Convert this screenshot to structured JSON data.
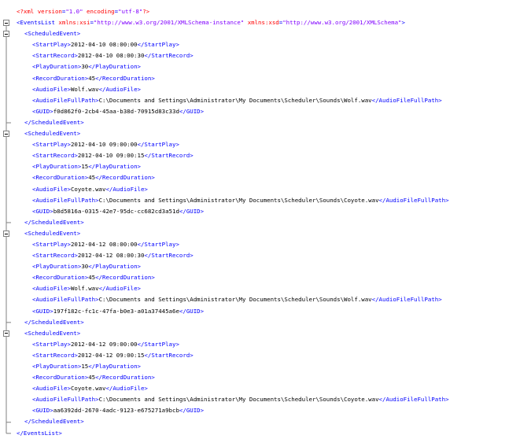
{
  "xml_declaration": {
    "open": "<?xml",
    "attrs": [
      {
        "name": "version",
        "value": "\"1.0\""
      },
      {
        "name": "encoding",
        "value": "\"utf-8\""
      }
    ],
    "close": "?>"
  },
  "root": {
    "tag": "EventsList",
    "attrs": [
      {
        "name": "xmlns:xsi",
        "value": "\"http://www.w3.org/2001/XMLSchema-instance\""
      },
      {
        "name": "xmlns:xsd",
        "value": "\"http://www.w3.org/2001/XMLSchema\""
      }
    ]
  },
  "child_tag": "ScheduledEvent",
  "field_names": [
    "StartPlay",
    "StartRecord",
    "PlayDuration",
    "RecordDuration",
    "AudioFile",
    "AudioFileFullPath",
    "GUID"
  ],
  "events": [
    {
      "StartPlay": "2012-04-10 08:00:00",
      "StartRecord": "2012-04-10 08:00:30",
      "PlayDuration": "30",
      "RecordDuration": "45",
      "AudioFile": "Wolf.wav",
      "AudioFileFullPath": "C:\\Documents and Settings\\Administrator\\My Documents\\Scheduler\\Sounds\\Wolf.wav",
      "GUID": "f0d862f0-2cb4-45aa-b38d-70915d83c33d"
    },
    {
      "StartPlay": "2012-04-10 09:00:00",
      "StartRecord": "2012-04-10 09:00:15",
      "PlayDuration": "15",
      "RecordDuration": "45",
      "AudioFile": "Coyote.wav",
      "AudioFileFullPath": "C:\\Documents and Settings\\Administrator\\My Documents\\Scheduler\\Sounds\\Coyote.wav",
      "GUID": "b8d5816a-0315-42e7-95dc-cc682cd3a51d"
    },
    {
      "StartPlay": "2012-04-12 08:00:00",
      "StartRecord": "2012-04-12 08:00:30",
      "PlayDuration": "30",
      "RecordDuration": "45",
      "AudioFile": "Wolf.wav",
      "AudioFileFullPath": "C:\\Documents and Settings\\Administrator\\My Documents\\Scheduler\\Sounds\\Wolf.wav",
      "GUID": "197f182c-fc1c-47fa-b0e3-a01a37445a6e"
    },
    {
      "StartPlay": "2012-04-12 09:00:00",
      "StartRecord": "2012-04-12 09:00:15",
      "PlayDuration": "15",
      "RecordDuration": "45",
      "AudioFile": "Coyote.wav",
      "AudioFileFullPath": "C:\\Documents and Settings\\Administrator\\My Documents\\Scheduler\\Sounds\\Coyote.wav",
      "GUID": "aa6392dd-2670-4adc-9123-e675271a9bcb"
    }
  ],
  "colors": {
    "tag": "#0000ff",
    "attribute": "#ff0000",
    "attribute_value": "#8000ff",
    "text": "#000000",
    "fold_guide": "#808080"
  },
  "icons": {
    "fold_marker": "fold-collapse-icon"
  }
}
